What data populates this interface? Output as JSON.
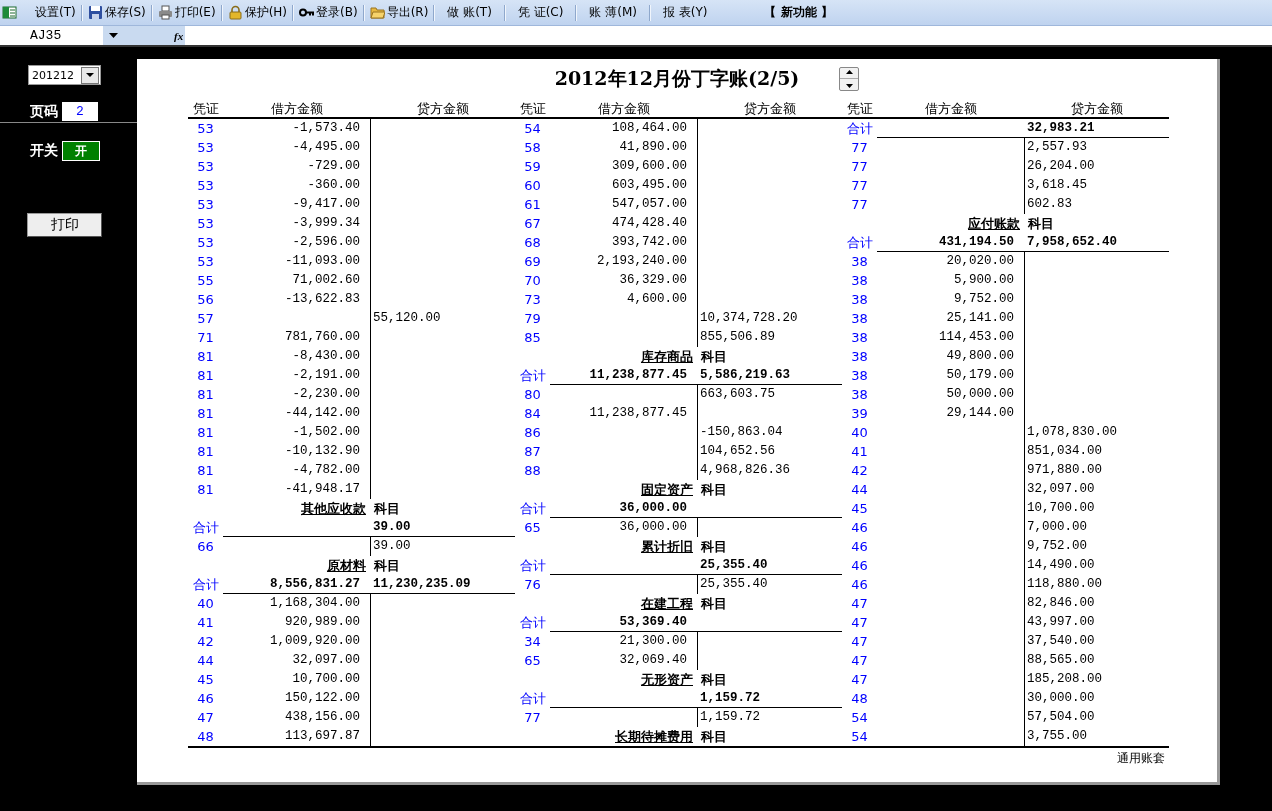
{
  "toolbar": {
    "items": [
      {
        "kind": "tool",
        "label": "设置(T)"
      },
      {
        "kind": "tool",
        "label": "保存(S)"
      },
      {
        "kind": "tool",
        "label": "打印(E)"
      },
      {
        "kind": "tool",
        "label": "保护(H)"
      },
      {
        "kind": "tool",
        "label": "登录(B)"
      },
      {
        "kind": "tool",
        "label": "导出(R)"
      },
      {
        "kind": "menu",
        "label": "做 账(T)"
      },
      {
        "kind": "menu",
        "label": "凭 证(C)"
      },
      {
        "kind": "menu",
        "label": "账 薄(M)"
      },
      {
        "kind": "menu",
        "label": "报 表(Y)"
      },
      {
        "kind": "feature",
        "label": "【 新功能 】"
      }
    ]
  },
  "formula_bar": {
    "name_box": "AJ35",
    "fx": "fx"
  },
  "left_panel": {
    "period": "201212",
    "page_label": "页码",
    "page": "2",
    "switch_label": "开关",
    "switch": {
      "label": "开",
      "on": true
    },
    "print_button": "打印"
  },
  "sheet": {
    "title": "2012年12月份丁字账(2/5)",
    "footer": "通用账套",
    "columns": [
      {
        "headers": [
          "凭证",
          "借方金额",
          "贷方金额"
        ],
        "rows": [
          {
            "kind": "entry",
            "voucher": "53",
            "debit": "-1,573.40"
          },
          {
            "kind": "entry",
            "voucher": "53",
            "debit": "-4,495.00"
          },
          {
            "kind": "entry",
            "voucher": "53",
            "debit": "-729.00"
          },
          {
            "kind": "entry",
            "voucher": "53",
            "debit": "-360.00"
          },
          {
            "kind": "entry",
            "voucher": "53",
            "debit": "-9,417.00"
          },
          {
            "kind": "entry",
            "voucher": "53",
            "debit": "-3,999.34"
          },
          {
            "kind": "entry",
            "voucher": "53",
            "debit": "-2,596.00"
          },
          {
            "kind": "entry",
            "voucher": "53",
            "debit": "-11,093.00"
          },
          {
            "kind": "entry",
            "voucher": "55",
            "debit": "71,002.60"
          },
          {
            "kind": "entry",
            "voucher": "56",
            "debit": "-13,622.83"
          },
          {
            "kind": "entry",
            "voucher": "57",
            "credit": "55,120.00"
          },
          {
            "kind": "entry",
            "voucher": "71",
            "debit": "781,760.00"
          },
          {
            "kind": "entry",
            "voucher": "81",
            "debit": "-8,430.00"
          },
          {
            "kind": "entry",
            "voucher": "81",
            "debit": "-2,191.00"
          },
          {
            "kind": "entry",
            "voucher": "81",
            "debit": "-2,230.00"
          },
          {
            "kind": "entry",
            "voucher": "81",
            "debit": "-44,142.00"
          },
          {
            "kind": "entry",
            "voucher": "81",
            "debit": "-1,502.00"
          },
          {
            "kind": "entry",
            "voucher": "81",
            "debit": "-10,132.90"
          },
          {
            "kind": "entry",
            "voucher": "81",
            "debit": "-4,782.00"
          },
          {
            "kind": "entry",
            "voucher": "81",
            "debit": "-41,948.17"
          },
          {
            "kind": "subject",
            "name": "其他应收款",
            "suffix": "科目"
          },
          {
            "kind": "total",
            "label": "合计",
            "credit": "39.00"
          },
          {
            "kind": "entry",
            "voucher": "66",
            "credit": "39.00"
          },
          {
            "kind": "subject",
            "name": "原材料",
            "suffix": "科目"
          },
          {
            "kind": "total",
            "label": "合计",
            "debit": "8,556,831.27",
            "credit": "11,230,235.09"
          },
          {
            "kind": "entry",
            "voucher": "40",
            "debit": "1,168,304.00"
          },
          {
            "kind": "entry",
            "voucher": "41",
            "debit": "920,989.00"
          },
          {
            "kind": "entry",
            "voucher": "42",
            "debit": "1,009,920.00"
          },
          {
            "kind": "entry",
            "voucher": "44",
            "debit": "32,097.00"
          },
          {
            "kind": "entry",
            "voucher": "45",
            "debit": "10,700.00"
          },
          {
            "kind": "entry",
            "voucher": "46",
            "debit": "150,122.00"
          },
          {
            "kind": "entry",
            "voucher": "47",
            "debit": "438,156.00"
          },
          {
            "kind": "entry",
            "voucher": "48",
            "debit": "113,697.87"
          }
        ]
      },
      {
        "headers": [
          "凭证",
          "借方金额",
          "贷方金额"
        ],
        "rows": [
          {
            "kind": "entry",
            "voucher": "54",
            "debit": "108,464.00"
          },
          {
            "kind": "entry",
            "voucher": "58",
            "debit": "41,890.00"
          },
          {
            "kind": "entry",
            "voucher": "59",
            "debit": "309,600.00"
          },
          {
            "kind": "entry",
            "voucher": "60",
            "debit": "603,495.00"
          },
          {
            "kind": "entry",
            "voucher": "61",
            "debit": "547,057.00"
          },
          {
            "kind": "entry",
            "voucher": "67",
            "debit": "474,428.40"
          },
          {
            "kind": "entry",
            "voucher": "68",
            "debit": "393,742.00"
          },
          {
            "kind": "entry",
            "voucher": "69",
            "debit": "2,193,240.00"
          },
          {
            "kind": "entry",
            "voucher": "70",
            "debit": "36,329.00"
          },
          {
            "kind": "entry",
            "voucher": "73",
            "debit": "4,600.00"
          },
          {
            "kind": "entry",
            "voucher": "79",
            "credit": "10,374,728.20"
          },
          {
            "kind": "entry",
            "voucher": "85",
            "credit": "855,506.89"
          },
          {
            "kind": "subject",
            "name": "库存商品",
            "suffix": "科目"
          },
          {
            "kind": "total",
            "label": "合计",
            "debit": "11,238,877.45",
            "credit": "5,586,219.63"
          },
          {
            "kind": "entry",
            "voucher": "80",
            "credit": "663,603.75"
          },
          {
            "kind": "entry",
            "voucher": "84",
            "debit": "11,238,877.45"
          },
          {
            "kind": "entry",
            "voucher": "86",
            "credit": "-150,863.04"
          },
          {
            "kind": "entry",
            "voucher": "87",
            "credit": "104,652.56"
          },
          {
            "kind": "entry",
            "voucher": "88",
            "credit": "4,968,826.36"
          },
          {
            "kind": "subject",
            "name": "固定资产",
            "suffix": "科目"
          },
          {
            "kind": "total",
            "label": "合计",
            "debit": "36,000.00"
          },
          {
            "kind": "entry",
            "voucher": "65",
            "debit": "36,000.00"
          },
          {
            "kind": "subject",
            "name": "累计折旧",
            "suffix": "科目"
          },
          {
            "kind": "total",
            "label": "合计",
            "credit": "25,355.40"
          },
          {
            "kind": "entry",
            "voucher": "76",
            "credit": "25,355.40"
          },
          {
            "kind": "subject",
            "name": "在建工程",
            "suffix": "科目"
          },
          {
            "kind": "total",
            "label": "合计",
            "debit": "53,369.40"
          },
          {
            "kind": "entry",
            "voucher": "34",
            "debit": "21,300.00"
          },
          {
            "kind": "entry",
            "voucher": "65",
            "debit": "32,069.40"
          },
          {
            "kind": "subject",
            "name": "无形资产",
            "suffix": "科目"
          },
          {
            "kind": "total",
            "label": "合计",
            "credit": "1,159.72"
          },
          {
            "kind": "entry",
            "voucher": "77",
            "credit": "1,159.72"
          },
          {
            "kind": "subject",
            "name": "长期待摊费用",
            "suffix": "科目"
          }
        ]
      },
      {
        "headers": [
          "凭证",
          "借方金额",
          "贷方金额"
        ],
        "rows": [
          {
            "kind": "total",
            "label": "合计",
            "credit": "32,983.21"
          },
          {
            "kind": "entry",
            "voucher": "77",
            "credit": "2,557.93"
          },
          {
            "kind": "entry",
            "voucher": "77",
            "credit": "26,204.00"
          },
          {
            "kind": "entry",
            "voucher": "77",
            "credit": "3,618.45"
          },
          {
            "kind": "entry",
            "voucher": "77",
            "credit": "602.83"
          },
          {
            "kind": "subject",
            "name": "应付账款",
            "suffix": "科目"
          },
          {
            "kind": "total",
            "label": "合计",
            "debit": "431,194.50",
            "credit": "7,958,652.40"
          },
          {
            "kind": "entry",
            "voucher": "38",
            "debit": "20,020.00"
          },
          {
            "kind": "entry",
            "voucher": "38",
            "debit": "5,900.00"
          },
          {
            "kind": "entry",
            "voucher": "38",
            "debit": "9,752.00"
          },
          {
            "kind": "entry",
            "voucher": "38",
            "debit": "25,141.00"
          },
          {
            "kind": "entry",
            "voucher": "38",
            "debit": "114,453.00"
          },
          {
            "kind": "entry",
            "voucher": "38",
            "debit": "49,800.00"
          },
          {
            "kind": "entry",
            "voucher": "38",
            "debit": "50,179.00"
          },
          {
            "kind": "entry",
            "voucher": "38",
            "debit": "50,000.00"
          },
          {
            "kind": "entry",
            "voucher": "39",
            "debit": "29,144.00"
          },
          {
            "kind": "entry",
            "voucher": "40",
            "credit": "1,078,830.00"
          },
          {
            "kind": "entry",
            "voucher": "41",
            "credit": "851,034.00"
          },
          {
            "kind": "entry",
            "voucher": "42",
            "credit": "971,880.00"
          },
          {
            "kind": "entry",
            "voucher": "44",
            "credit": "32,097.00"
          },
          {
            "kind": "entry",
            "voucher": "45",
            "credit": "10,700.00"
          },
          {
            "kind": "entry",
            "voucher": "46",
            "credit": "7,000.00"
          },
          {
            "kind": "entry",
            "voucher": "46",
            "credit": "9,752.00"
          },
          {
            "kind": "entry",
            "voucher": "46",
            "credit": "14,490.00"
          },
          {
            "kind": "entry",
            "voucher": "46",
            "credit": "118,880.00"
          },
          {
            "kind": "entry",
            "voucher": "47",
            "credit": "82,846.00"
          },
          {
            "kind": "entry",
            "voucher": "47",
            "credit": "43,997.00"
          },
          {
            "kind": "entry",
            "voucher": "47",
            "credit": "37,540.00"
          },
          {
            "kind": "entry",
            "voucher": "47",
            "credit": "88,565.00"
          },
          {
            "kind": "entry",
            "voucher": "47",
            "credit": "185,208.00"
          },
          {
            "kind": "entry",
            "voucher": "48",
            "credit": "30,000.00"
          },
          {
            "kind": "entry",
            "voucher": "54",
            "credit": "57,504.00"
          },
          {
            "kind": "entry",
            "voucher": "54",
            "credit": "3,755.00"
          }
        ]
      }
    ]
  }
}
